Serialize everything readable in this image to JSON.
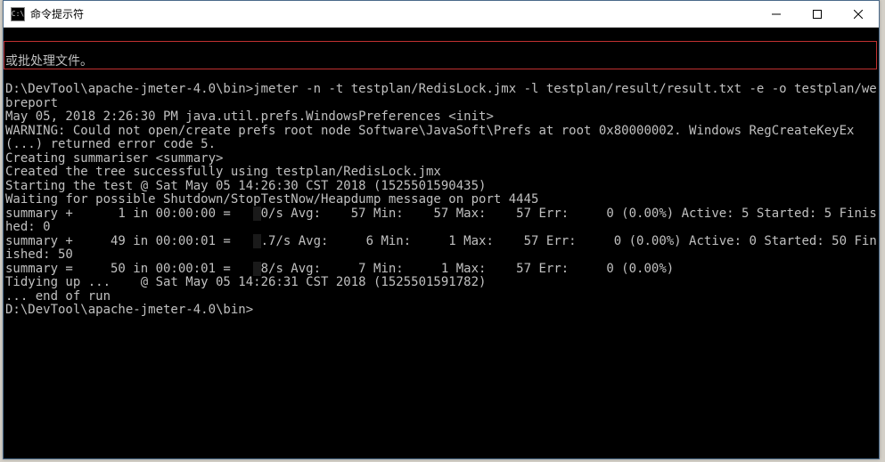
{
  "window": {
    "title": "命令提示符",
    "icon_label": "C:\\"
  },
  "terminal": {
    "line_partial_top": "或批处理文件。",
    "blank": "",
    "cmd_prompt": "D:\\DevTool\\apache-jmeter-4.0\\bin>",
    "cmd_text": "jmeter -n -t testplan/RedisLock.jmx -l testplan/result/result.txt -e -o testplan/webreport",
    "out01": "May 05, 2018 2:26:30 PM java.util.prefs.WindowsPreferences <init>",
    "out02": "WARNING: Could not open/create prefs root node Software\\JavaSoft\\Prefs at root 0x80000002. Windows RegCreateKeyEx(...) returned error code 5.",
    "out03": "Creating summariser <summary>",
    "out04": "Created the tree successfully using testplan/RedisLock.jmx",
    "out05": "Starting the test @ Sat May 05 14:26:30 CST 2018 (1525501590435)",
    "out06": "Waiting for possible Shutdown/StopTestNow/Heapdump message on port 4445",
    "sum1_a": "summary +      1 in 00:00:00 =   ",
    "sum1_r": " ",
    "sum1_b": "0/s Avg:    57 Min:    57 Max:    57 Err:     0 (0.00%) Active: 5 Started: 5 Finished: 0",
    "sum2_a": "summary +     49 in 00:00:01 =   ",
    "sum2_r": " ",
    "sum2_b": ".7/s Avg:     6 Min:     1 Max:    57 Err:     0 (0.00%) Active: 0 Started: 50 Finished: 50",
    "sum3_a": "summary =     50 in 00:00:01 =   ",
    "sum3_r": " ",
    "sum3_b": "8/s Avg:     7 Min:     1 Max:    57 Err:     0 (0.00%)",
    "out09": "Tidying up ...    @ Sat May 05 14:26:31 CST 2018 (1525501591782)",
    "out10": "... end of run",
    "prompt2": "D:\\DevTool\\apache-jmeter-4.0\\bin>"
  }
}
